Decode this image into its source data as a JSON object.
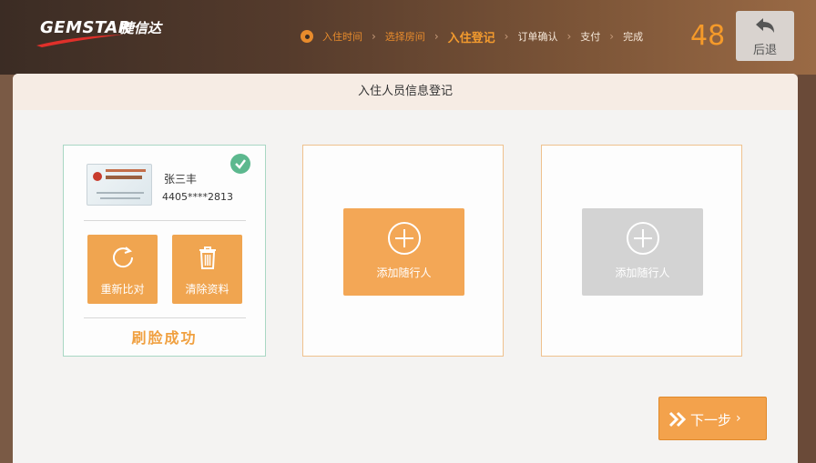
{
  "header": {
    "logo_text": "GEMSTAR",
    "logo_cn": "捷信达",
    "steps": [
      {
        "label": "入住时间",
        "state": "done"
      },
      {
        "label": "选择房间",
        "state": "done"
      },
      {
        "label": "入住登记",
        "state": "active"
      },
      {
        "label": "订单确认",
        "state": "future"
      },
      {
        "label": "支付",
        "state": "future"
      },
      {
        "label": "完成",
        "state": "future"
      }
    ],
    "countdown": "48",
    "back_label": "后退"
  },
  "panel": {
    "title": "入住人员信息登记",
    "guest": {
      "name": "张三丰",
      "id_number": "4405****2813",
      "rescan_label": "重新比对",
      "clear_label": "清除资料",
      "status": "刷脸成功"
    },
    "companions": [
      {
        "label": "添加随行人",
        "enabled": true
      },
      {
        "label": "添加随行人",
        "enabled": false
      }
    ],
    "next_label": "下一步"
  },
  "colors": {
    "accent": "#f3a24c",
    "success": "#5cb88e",
    "disabled": "#d3d3d3"
  }
}
